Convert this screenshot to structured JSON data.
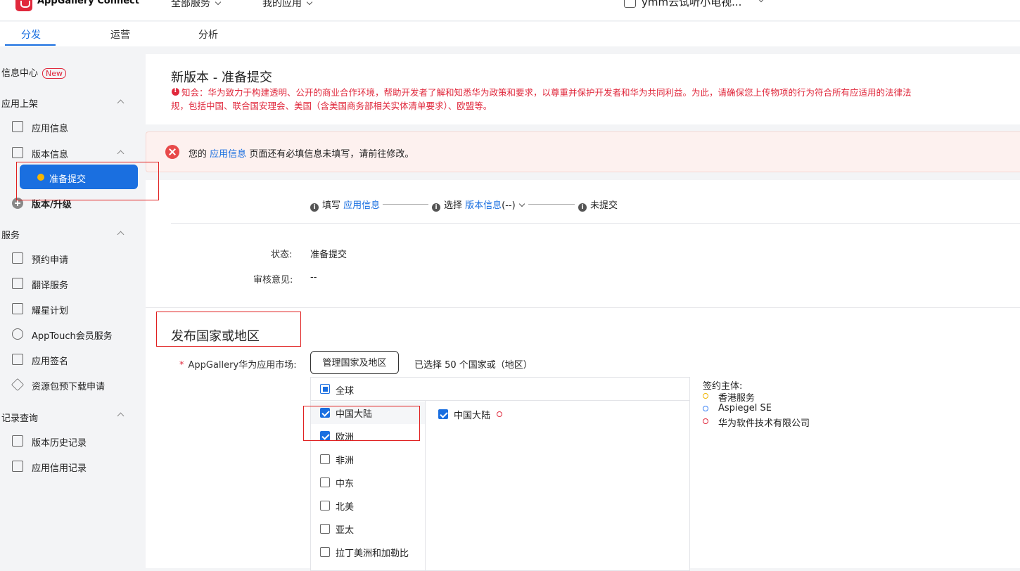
{
  "topbar": {
    "logo_text": "AppGallery Connect",
    "nav_all_services": "全部服务",
    "nav_my_apps": "我的应用",
    "app_name": "ymm云试听小电视..."
  },
  "tabs": [
    {
      "label": "分发",
      "active": true
    },
    {
      "label": "运营",
      "active": false
    },
    {
      "label": "分析",
      "active": false
    }
  ],
  "sidebar": {
    "info_center": "信息中心",
    "new_badge": "New",
    "group_publish": "应用上架",
    "app_info": "应用信息",
    "version_info": "版本信息",
    "prepare_submit": "准备提交",
    "version_upgrade": "版本/升级",
    "group_services": "服务",
    "services": [
      "预约申请",
      "翻译服务",
      "耀星计划",
      "AppTouch会员服务",
      "应用签名",
      "资源包预下载申请"
    ],
    "group_records": "记录查询",
    "records": [
      "版本历史记录",
      "应用信用记录"
    ]
  },
  "main": {
    "title": "新版本 - 准备提交",
    "notice_line1": "知会：华为致力于构建透明、公开的商业合作环境，帮助开发者了解和知悉华为政策和要求，以尊重并保护开发者和华为共同利益。为此，请确保您上传物项的行为符合所有应适用的法律法",
    "notice_line2": "规，包括中国、联合国安理会、美国（含美国商务部相关实体清单要求）、欧盟等。",
    "alert_prefix": "您的",
    "alert_link": "应用信息",
    "alert_suffix": "页面还有必填信息未填写，请前往修改。",
    "steps": {
      "s1_prefix": "填写",
      "s1_link": "应用信息",
      "s2_prefix": "选择",
      "s2_link": "版本信息",
      "s2_suffix": "(--)",
      "s3": "未提交"
    },
    "status_label": "状态:",
    "status_value": "准备提交",
    "review_label": "审核意见:",
    "review_value": "--",
    "section_title": "发布国家或地区",
    "market_label": "AppGallery华为应用市场:",
    "manage_button": "管理国家及地区",
    "selected_text": "已选择 50 个国家或（地区）",
    "global_label": "全球",
    "regions": [
      {
        "label": "中国大陆",
        "checked": true
      },
      {
        "label": "欧洲",
        "checked": true
      },
      {
        "label": "非洲",
        "checked": false
      },
      {
        "label": "中东",
        "checked": false
      },
      {
        "label": "北美",
        "checked": false
      },
      {
        "label": "亚太",
        "checked": false
      },
      {
        "label": "拉丁美洲和加勒比",
        "checked": false
      }
    ],
    "sub_region": "中国大陆",
    "legend_title": "签约主体:",
    "legend": [
      {
        "label": "香港服务",
        "color": "#f0b400"
      },
      {
        "label": "Aspiegel SE",
        "color": "#3b82f6"
      },
      {
        "label": "华为软件技术有限公司",
        "color": "#e0283c"
      }
    ]
  }
}
